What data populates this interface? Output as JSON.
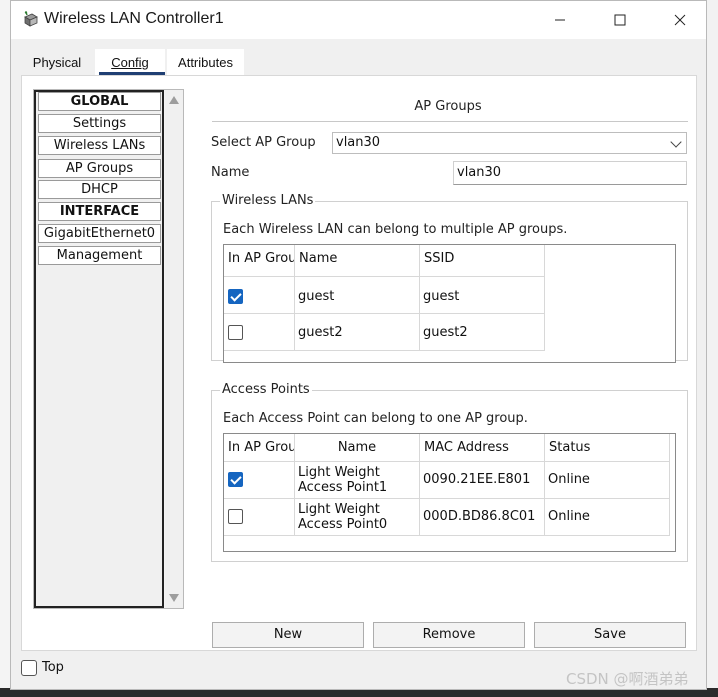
{
  "window": {
    "title": "Wireless LAN Controller1"
  },
  "tabs": [
    "Physical",
    "Config",
    "Attributes"
  ],
  "sidebar": {
    "items": [
      {
        "label": "GLOBAL",
        "section": true
      },
      {
        "label": "Settings"
      },
      {
        "label": "Wireless LANs"
      },
      {
        "label": "AP Groups"
      },
      {
        "label": "DHCP"
      },
      {
        "label": "INTERFACE",
        "section": true
      },
      {
        "label": "GigabitEthernet0"
      },
      {
        "label": "Management"
      }
    ]
  },
  "pane": {
    "title": "AP Groups",
    "select_label": "Select AP Group",
    "select_value": "vlan30",
    "name_label": "Name",
    "name_value": "vlan30"
  },
  "wireless_lans": {
    "title": "Wireless LANs",
    "description": "Each Wireless LAN can belong to multiple AP groups.",
    "columns": [
      "In AP Grou",
      "Name",
      "SSID"
    ],
    "rows": [
      {
        "checked": true,
        "name": "guest",
        "ssid": "guest"
      },
      {
        "checked": false,
        "name": "guest2",
        "ssid": "guest2"
      }
    ]
  },
  "access_points": {
    "title": "Access Points",
    "description": "Each Access Point can belong to one AP group.",
    "columns": [
      "In AP Grou",
      "Name",
      "MAC Address",
      "Status"
    ],
    "rows": [
      {
        "checked": true,
        "name_line1": "Light Weight",
        "name_line2": "Access Point1",
        "mac": "0090.21EE.E801",
        "status": "Online"
      },
      {
        "checked": false,
        "name_line1": "Light Weight",
        "name_line2": "Access Point0",
        "mac": "000D.BD86.8C01",
        "status": "Online"
      }
    ]
  },
  "buttons": {
    "new": "New",
    "remove": "Remove",
    "save": "Save"
  },
  "footer": {
    "top_label": "Top",
    "top_checked": false
  },
  "watermark": "CSDN @啊酒弟弟",
  "colors": {
    "accent": "#1565c0",
    "tab_underline": "#1f3f73"
  }
}
